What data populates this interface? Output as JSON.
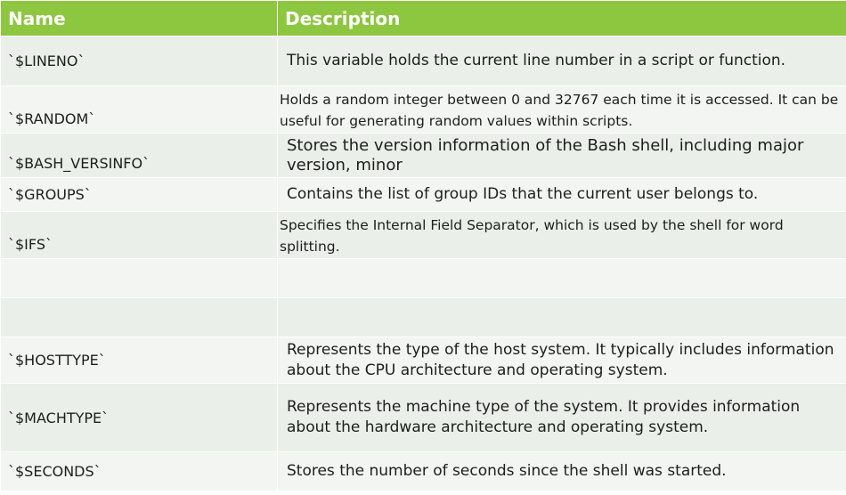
{
  "table": {
    "headers": {
      "name": "Name",
      "description": "Description"
    },
    "rows": [
      {
        "name": "`$LINENO`",
        "description": "This variable holds the current line number in a script or function."
      },
      {
        "name": "`$RANDOM`",
        "description": "Holds a random integer between 0 and 32767 each time it is accessed. It can be useful for generating random values within scripts."
      },
      {
        "name": "`$BASH_VERSINFO`",
        "description": "Stores the version information of the Bash shell, including major version, minor"
      },
      {
        "name": "`$GROUPS`",
        "description": "Contains the list of group IDs that the current user belongs to."
      },
      {
        "name": "`$IFS`",
        "description": "Specifies the Internal Field Separator, which is used by the shell for word splitting."
      },
      {
        "name": "",
        "description": ""
      },
      {
        "name": "",
        "description": ""
      },
      {
        "name": "`$HOSTTYPE`",
        "description": "Represents the type of the host system. It typically includes information about the CPU architecture and operating system."
      },
      {
        "name": "`$MACHTYPE`",
        "description": "Represents the machine type of the system. It provides information about the hardware architecture and operating system."
      },
      {
        "name": "`$SECONDS`",
        "description": "Stores the number of seconds since the shell was started."
      }
    ]
  },
  "colors": {
    "header_bg": "#8dc63f",
    "row_bg": "#eaefe9",
    "row_alt_bg": "#f2f5f1",
    "text": "#1e1e1e"
  }
}
